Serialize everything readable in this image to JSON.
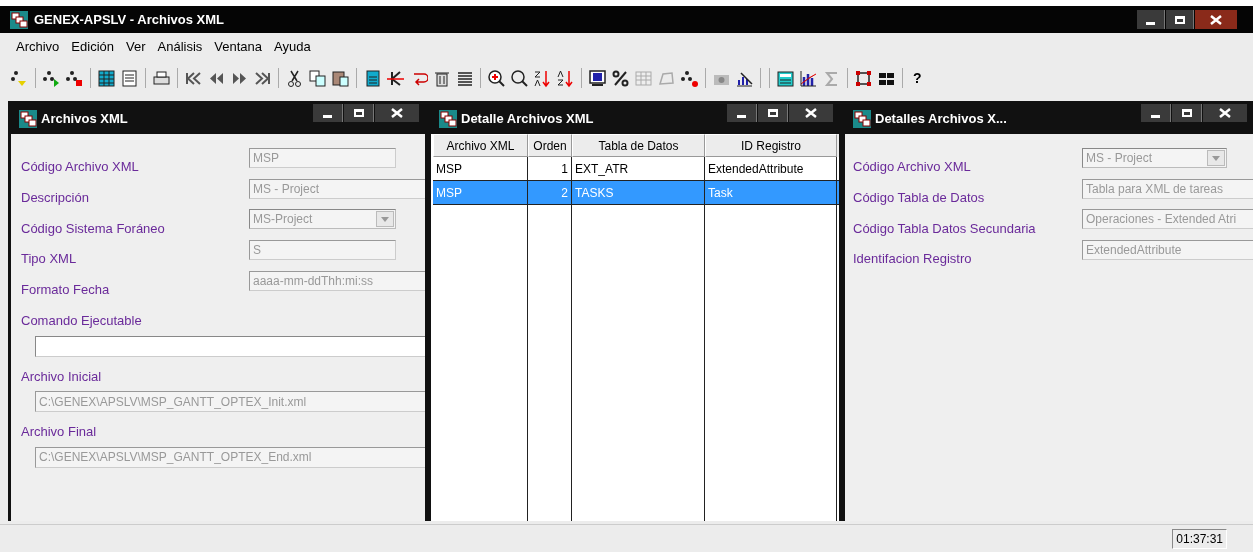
{
  "window": {
    "title": "GENEX-APSLV - Archivos XML"
  },
  "menu": [
    "Archivo",
    "Edición",
    "Ver",
    "Análisis",
    "Ventana",
    "Ayuda"
  ],
  "toolbar": {
    "help_label": "?"
  },
  "archivos_window": {
    "title": "Archivos XML",
    "fields": [
      {
        "label": "Código Archivo XML",
        "kind": "text",
        "value": "MSP"
      },
      {
        "label": "Descripción",
        "kind": "text",
        "value": "MS - Project"
      },
      {
        "label": "Código Sistema Foráneo",
        "kind": "combo",
        "value": "MS-Project"
      },
      {
        "label": "Tipo XML",
        "kind": "text",
        "value": "S"
      },
      {
        "label": "Formato Fecha",
        "kind": "text",
        "value": "aaaa-mm-ddThh:mi:ss"
      }
    ],
    "blocks": [
      {
        "label": "Comando Ejecutable",
        "editable": true
      },
      {
        "label": "Archivo Inicial",
        "editable": false,
        "value": "C:\\GENEX\\APSLV\\MSP_GANTT_OPTEX_Init.xml"
      },
      {
        "label": "Archivo Final",
        "editable": false,
        "value": "C:\\GENEX\\APSLV\\MSP_GANTT_OPTEX_End.xml"
      }
    ]
  },
  "detalle_window": {
    "title": "Detalle Archivos XML",
    "table": {
      "columns": [
        "Archivo XML",
        "Orden",
        "Tabla de Datos",
        "ID Registro"
      ],
      "rows": [
        {
          "cells": [
            "MSP",
            "1",
            "EXT_ATR",
            "ExtendedAttribute"
          ],
          "selected": false
        },
        {
          "cells": [
            "MSP",
            "2",
            "TASKS",
            "Task"
          ],
          "selected": true
        }
      ]
    }
  },
  "detalles_window": {
    "title": "Detalles Archivos X...",
    "fields": [
      {
        "label": "Código Archivo XML",
        "kind": "combo",
        "value": "MS - Project"
      },
      {
        "label": "Código Tabla de Datos",
        "kind": "text",
        "value": "Tabla para XML de tareas"
      },
      {
        "label": "Código Tabla Datos Secundaria",
        "kind": "text",
        "value": "Operaciones  - Extended Atri"
      },
      {
        "label": "Identifacion Registro",
        "kind": "text",
        "value": "ExtendedAttribute"
      }
    ]
  },
  "status_bar": {
    "time": "01:37:31"
  }
}
